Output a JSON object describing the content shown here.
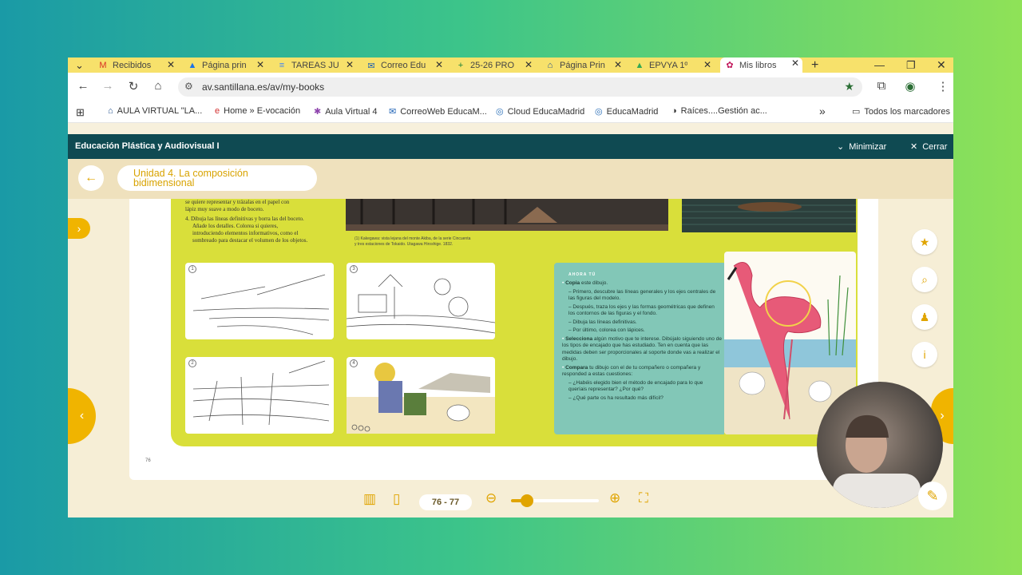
{
  "browser": {
    "tabs": [
      {
        "label": "Recibidos",
        "icon": "gmail-icon",
        "glyph": "M",
        "color": "#d93025"
      },
      {
        "label": "Página prin",
        "icon": "drive-icon",
        "glyph": "▲",
        "color": "#1a73e8"
      },
      {
        "label": "TAREAS JU",
        "icon": "docs-icon",
        "glyph": "≡",
        "color": "#4285f4"
      },
      {
        "label": "Correo Edu",
        "icon": "mail-icon",
        "glyph": "✉",
        "color": "#1a5fb4"
      },
      {
        "label": "25-26 PRO",
        "icon": "sheets-icon",
        "glyph": "+",
        "color": "#188038"
      },
      {
        "label": "Página Prin",
        "icon": "cap-icon",
        "glyph": "⌂",
        "color": "#1f4e8c"
      },
      {
        "label": "EPVYA 1º",
        "icon": "drive-icon",
        "glyph": "▲",
        "color": "#34a853"
      },
      {
        "label": "Mis libros",
        "icon": "santillana-icon",
        "glyph": "✿",
        "color": "#c2185b"
      }
    ],
    "new_tab": "+",
    "url": "av.santillana.es/av/my-books",
    "bookmarks": [
      {
        "label": "AULA VIRTUAL \"LA...",
        "icon": "cap-icon",
        "glyph": "⌂",
        "color": "#1f4e8c"
      },
      {
        "label": "Home » E-vocación",
        "icon": "evocacion-icon",
        "glyph": "e",
        "color": "#d32f2f"
      },
      {
        "label": "Aula Virtual 4",
        "icon": "sparkle-icon",
        "glyph": "✱",
        "color": "#8e44ad"
      },
      {
        "label": "CorreoWeb EducaM...",
        "icon": "mail-icon",
        "glyph": "✉",
        "color": "#1a5fb4"
      },
      {
        "label": "Cloud EducaMadrid",
        "icon": "cloud-icon",
        "glyph": "◎",
        "color": "#2a6fb8"
      },
      {
        "label": "EducaMadrid",
        "icon": "educamadrid-icon",
        "glyph": "◎",
        "color": "#2a6fb8"
      },
      {
        "label": "Raíces....Gestión ac...",
        "icon": "raices-icon",
        "glyph": "◑",
        "color": "#333333"
      }
    ],
    "all_bookmarks": "Todos los marcadores",
    "more": "»"
  },
  "app": {
    "title": "Educación Plástica y Audiovisual I",
    "minimize": "Minimizar",
    "close": "Cerrar",
    "unit_title_line1": "Unidad 4. La composición",
    "unit_title_line2": "bidimensional",
    "page_range": "76 - 77",
    "zoom_level": 0.18
  },
  "book": {
    "intro_lines": [
      "se quiere representar y trázalas en el papel con",
      "lápiz muy suave a modo de boceto.",
      "4.  Dibuja las líneas definitivas y borra las del boceto.",
      "Añade los detalles. Colorea si quieres,",
      "introduciendo elementos informativos, como el",
      "sombreado para destacar el volumen de los objetos."
    ],
    "caption_lines": [
      "(1)  Kakegawa: vista lejana del monte Akiba, de la serie Cincuenta",
      "y tres estaciones de Tokaido. Utagawa Hiroshige. 1832."
    ],
    "sketch_numbers": [
      "1",
      "3",
      "2",
      "4"
    ],
    "ahora_tu": "AHORA TÚ",
    "activity": [
      {
        "type": "bullet",
        "bold": "Copia",
        "text": " este dibujo."
      },
      {
        "type": "sub",
        "text": "– Primero, descubre las líneas generales y los ejes centrales de las figuras del modelo."
      },
      {
        "type": "sub",
        "text": "– Después, traza los ejes y las formas geométricas que definen los contornos de las figuras y el fondo."
      },
      {
        "type": "sub",
        "text": "– Dibuja las líneas definitivas."
      },
      {
        "type": "sub",
        "text": "– Por último, colorea con lápices."
      },
      {
        "type": "bullet",
        "bold": "Selecciona",
        "text": " algún motivo que te interese. Dibújalo siguiendo uno de los tipos de encajado que has estudiado. Ten en cuenta que las medidas deben ser proporcionales al soporte donde vas a realizar el dibujo."
      },
      {
        "type": "bullet",
        "bold": "Compara",
        "text": " tu dibujo con el de tu compañero o compañera y responded a estas cuestiones:"
      },
      {
        "type": "sub",
        "text": "– ¿Habéis elegido bien el método de encajado para lo que queríais representar? ¿Por qué?"
      },
      {
        "type": "sub",
        "text": "– ¿Qué parte os ha resultado más difícil?"
      }
    ],
    "page_number": "76"
  },
  "colors": {
    "accent": "#e0a400",
    "header": "#0f4a52",
    "lime": "#d9df3a",
    "teal": "#82c7b7",
    "tabbar": "#f7e16b"
  }
}
